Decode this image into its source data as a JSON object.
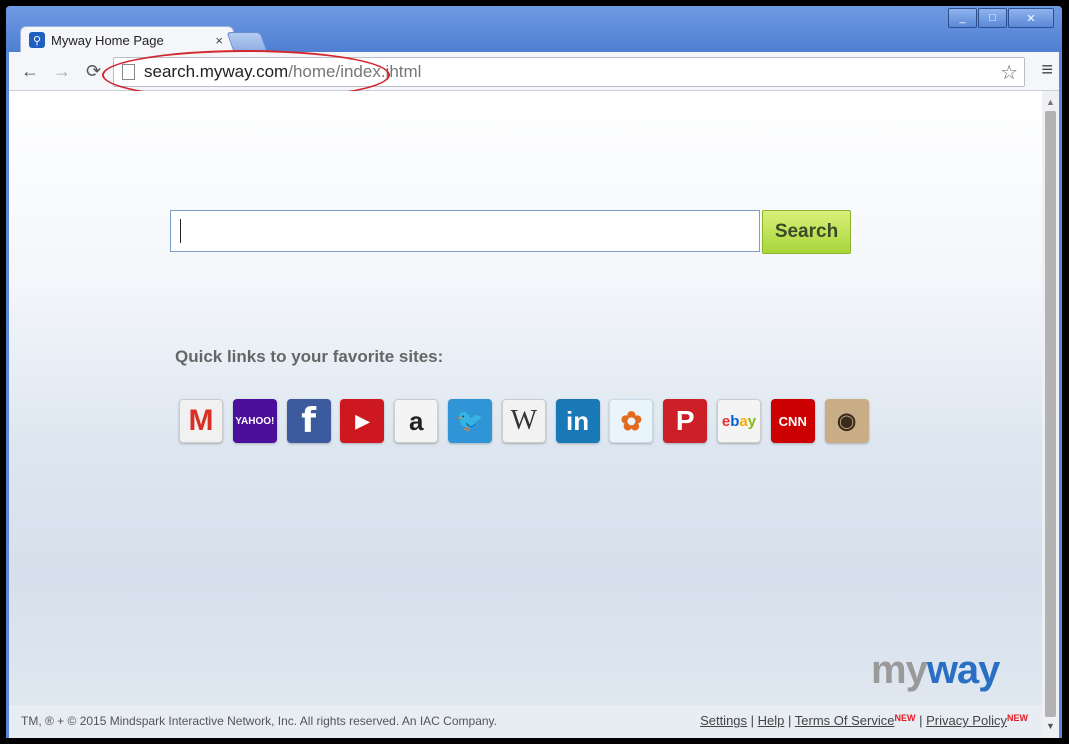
{
  "browser": {
    "tab": {
      "title": "Myway Home Page",
      "close": "×"
    },
    "window_controls": {
      "minimize": "_",
      "maximize": "□",
      "close": "✕"
    },
    "nav": {
      "back": "←",
      "forward": "→",
      "reload": "⟳"
    },
    "address": {
      "host": "search.myway.com",
      "path": "/home/index.jhtml"
    },
    "star": "☆",
    "menu": "≡",
    "scroll": {
      "up": "▲",
      "down": "▼"
    }
  },
  "page": {
    "search": {
      "value": "",
      "button_label": "Search"
    },
    "quick_links": {
      "title": "Quick links to your favorite sites:",
      "items": [
        {
          "name": "gmail",
          "glyph": "M"
        },
        {
          "name": "yahoo",
          "glyph": "YAHOO!"
        },
        {
          "name": "facebook",
          "glyph": "f"
        },
        {
          "name": "youtube",
          "glyph": "▶"
        },
        {
          "name": "amazon",
          "glyph": "a"
        },
        {
          "name": "twitter",
          "glyph": "🐦"
        },
        {
          "name": "wikipedia",
          "glyph": "W"
        },
        {
          "name": "linkedin",
          "glyph": "in"
        },
        {
          "name": "msn",
          "glyph": "✿"
        },
        {
          "name": "pinterest",
          "glyph": "P"
        },
        {
          "name": "ebay",
          "glyph": "ebay"
        },
        {
          "name": "cnn",
          "glyph": "CNN"
        },
        {
          "name": "instagram",
          "glyph": "◉"
        }
      ]
    },
    "logo": {
      "my": "my",
      "way": "way"
    },
    "footer": {
      "copyright": "TM, ® + © 2015 Mindspark Interactive Network, Inc. All rights reserved. An IAC Company.",
      "settings": "Settings",
      "help": "Help",
      "terms": "Terms Of Service",
      "privacy": "Privacy Policy",
      "new_badge": "NEW",
      "separator": " | "
    }
  },
  "colors": {
    "annotation": "#d3272f",
    "search_button": "#a9d63a",
    "logo_blue": "#2a6fc4"
  }
}
